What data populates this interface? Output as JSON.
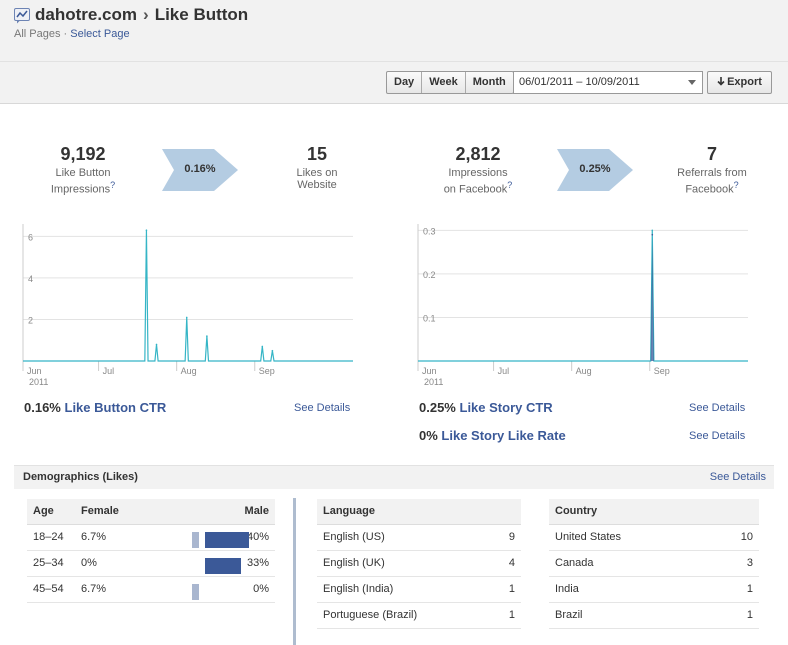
{
  "header": {
    "site": "dahotre.com",
    "separator": "›",
    "page": "Like Button",
    "breadcrumb_all": "All Pages",
    "breadcrumb_sep": "·",
    "breadcrumb_select": "Select Page"
  },
  "toolbar": {
    "range_buttons": [
      "Day",
      "Week",
      "Month"
    ],
    "date_range": "06/01/2011 – 10/09/2011",
    "export_label": "Export",
    "export_icon": "down-arrow-icon"
  },
  "funnels": {
    "left": {
      "from_value": "9,192",
      "from_label_1": "Like Button",
      "from_label_2": "Impressions",
      "rate": "0.16%",
      "to_value": "15",
      "to_label_1": "Likes on",
      "to_label_2": "Website"
    },
    "right": {
      "from_value": "2,812",
      "from_label_1": "Impressions",
      "from_label_2": "on Facebook",
      "rate": "0.25%",
      "to_value": "7",
      "to_label_1": "Referrals from",
      "to_label_2": "Facebook"
    },
    "help_mark": "?"
  },
  "chart_data": [
    {
      "type": "line",
      "x_labels": [
        "Jun",
        "Jul",
        "Aug",
        "Sep"
      ],
      "x_sublabel": "2011",
      "y_ticks": [
        "6",
        "4",
        "2"
      ],
      "ylim": [
        0,
        6.5
      ],
      "grid": true,
      "series": [
        {
          "color": "#35b5c6",
          "points": [
            {
              "x": "2011-07-20",
              "y": 6.3
            },
            {
              "x": "2011-07-24",
              "y": 0.8
            },
            {
              "x": "2011-08-05",
              "y": 2.1
            },
            {
              "x": "2011-08-13",
              "y": 1.2
            },
            {
              "x": "2011-09-04",
              "y": 0.7
            },
            {
              "x": "2011-09-08",
              "y": 0.5
            }
          ]
        }
      ]
    },
    {
      "type": "line",
      "x_labels": [
        "Jun",
        "Jul",
        "Aug",
        "Sep"
      ],
      "x_sublabel": "2011",
      "y_ticks": [
        "0.3",
        "0.2",
        "0.1"
      ],
      "ylim": [
        0,
        0.31
      ],
      "grid": true,
      "series": [
        {
          "color": "#35b5c6",
          "points": [
            {
              "x": "2011-09-02",
              "y": 0.3
            }
          ]
        },
        {
          "color": "#3b5998",
          "points": [
            {
              "x": "2011-09-02",
              "y": 0.29
            }
          ]
        }
      ]
    }
  ],
  "ctr": {
    "left_value": "0.16%",
    "left_link": "Like Button CTR",
    "right_value_1": "0.25%",
    "right_link_1": "Like Story CTR",
    "right_value_2": "0%",
    "right_link_2": "Like Story Like Rate",
    "see_details": "See Details"
  },
  "demographics": {
    "title": "Demographics (Likes)",
    "see_details": "See Details",
    "age": {
      "headers": [
        "Age",
        "Female",
        "Male"
      ],
      "rows": [
        {
          "age": "18–24",
          "female": "6.7%",
          "male": "40%",
          "female_pct": 6.7,
          "male_pct": 40
        },
        {
          "age": "25–34",
          "female": "0%",
          "male": "33%",
          "female_pct": 0,
          "male_pct": 33
        },
        {
          "age": "45–54",
          "female": "6.7%",
          "male": "0%",
          "female_pct": 6.7,
          "male_pct": 0
        }
      ]
    },
    "language": {
      "header": "Language",
      "rows": [
        {
          "name": "English (US)",
          "count": "9"
        },
        {
          "name": "English (UK)",
          "count": "4"
        },
        {
          "name": "English (India)",
          "count": "1"
        },
        {
          "name": "Portuguese (Brazil)",
          "count": "1"
        }
      ]
    },
    "country": {
      "header": "Country",
      "rows": [
        {
          "name": "United States",
          "count": "10"
        },
        {
          "name": "Canada",
          "count": "3"
        },
        {
          "name": "India",
          "count": "1"
        },
        {
          "name": "Brazil",
          "count": "1"
        }
      ]
    }
  }
}
